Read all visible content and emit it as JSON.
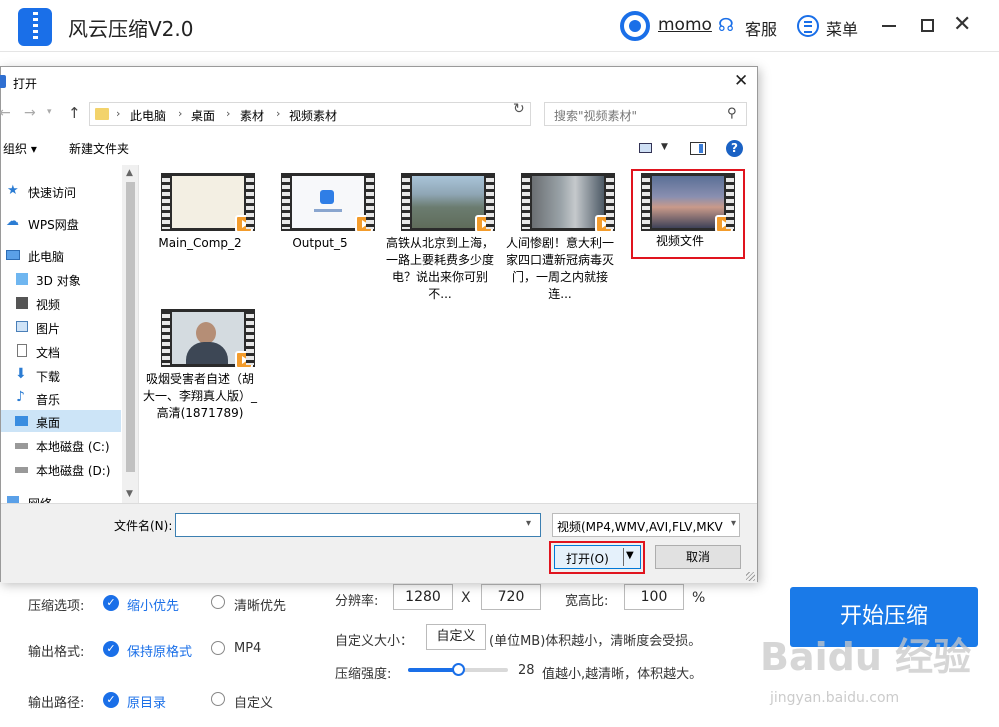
{
  "app": {
    "title": "风云压缩V2.0",
    "user_name": "momo",
    "service_label": "客服",
    "menu_label": "菜单",
    "min_icon": "minimize-icon",
    "max_icon": "maximize-icon",
    "close_icon": "close-icon"
  },
  "settings": {
    "compress_option_label": "压缩选项:",
    "compress_small": "缩小优先",
    "compress_clear": "清晰优先",
    "output_format_label": "输出格式:",
    "keep_format": "保持原格式",
    "mp4": "MP4",
    "output_path_label": "输出路径:",
    "original_dir": "原目录",
    "custom_dir": "自定义",
    "resolution_label": "分辨率:",
    "width": "1280",
    "x": "X",
    "height": "720",
    "aspect_label": "宽高比:",
    "aspect_value": "100",
    "percent": "%",
    "custom_size_label": "自定义大小：",
    "custom_size_btn": "自定义",
    "custom_size_hint": "(单位MB)体积越小，清晰度会受损。",
    "strength_label": "压缩强度:",
    "strength_value": "28",
    "strength_level": 0.5,
    "strength_hint": "值越小,越清晰，体积越大。",
    "start_button": "开始压缩"
  },
  "watermark": {
    "main": "Baidu 经验",
    "sub": "jingyan.baidu.com"
  },
  "dialog": {
    "title": "打开",
    "breadcrumbs": [
      "此电脑",
      "桌面",
      "素材",
      "视频素材"
    ],
    "search_placeholder": "搜索\"视频素材\"",
    "organize": "组织 ▾",
    "new_folder": "新建文件夹",
    "sidebar": [
      {
        "label": "快速访问",
        "icon": "star-icon"
      },
      {
        "label": "WPS网盘",
        "icon": "cloud-icon"
      },
      {
        "label": "此电脑",
        "icon": "computer-icon"
      },
      {
        "label": "3D 对象",
        "icon": "cube-icon"
      },
      {
        "label": "视频",
        "icon": "video-icon"
      },
      {
        "label": "图片",
        "icon": "picture-icon"
      },
      {
        "label": "文档",
        "icon": "document-icon"
      },
      {
        "label": "下载",
        "icon": "download-icon"
      },
      {
        "label": "音乐",
        "icon": "music-icon"
      },
      {
        "label": "桌面",
        "icon": "desktop-icon"
      },
      {
        "label": "本地磁盘 (C:)",
        "icon": "drive-icon"
      },
      {
        "label": "本地磁盘 (D:)",
        "icon": "drive-icon"
      },
      {
        "label": "网络",
        "icon": "network-icon"
      }
    ],
    "files": [
      {
        "name": "Main_Comp_2"
      },
      {
        "name": "Output_5"
      },
      {
        "name": "高铁从北京到上海，一路上要耗费多少度电？说出来你可别不..."
      },
      {
        "name": "人间惨剧！意大利一家四口遭新冠病毒灭门，一周之内就接连..."
      },
      {
        "name": "视频文件"
      },
      {
        "name": "吸烟受害者自述（胡大一、李翔真人版）_高清(1871789)"
      }
    ],
    "filename_label": "文件名(N):",
    "filename_value": "",
    "filter": "视频(MP4,WMV,AVI,FLV,MKV",
    "open_button": "打开(O)",
    "cancel_button": "取消"
  }
}
